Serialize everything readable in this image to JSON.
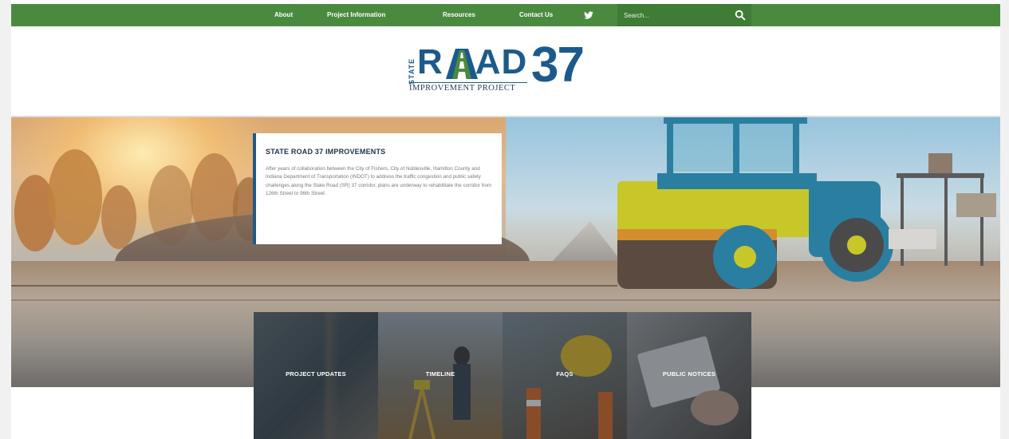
{
  "nav": {
    "items": [
      "About",
      "Project Information",
      "Resources",
      "Contact Us"
    ],
    "twitter_icon": "twitter-icon",
    "search_placeholder": "Search...",
    "search_icon": "search-icon",
    "bar_color": "#4a8a3f"
  },
  "logo": {
    "state": "STATE",
    "road_r": "R",
    "road_rest": "AD",
    "number": "37",
    "subtitle": "IMPROVEMENT PROJECT",
    "brand_color": "#1d5a8c",
    "accent_color": "#4a8a3f"
  },
  "hero": {
    "card_title": "STATE ROAD 37 IMPROVEMENTS",
    "card_body": "After years of collaboration between the City of Fishers, City of Noblesville, Hamilton County and Indiana Department of Transportation (INDOT) to address the traffic congestion and public safety challenges along the State Road (SR) 37 corridor, plans are underway to rehabilitate the corridor from 126th Street to 96th Street."
  },
  "tiles": [
    {
      "label": "PROJECT UPDATES"
    },
    {
      "label": "TIMELINE"
    },
    {
      "label": "FAQS"
    },
    {
      "label": "PUBLIC NOTICES"
    }
  ]
}
